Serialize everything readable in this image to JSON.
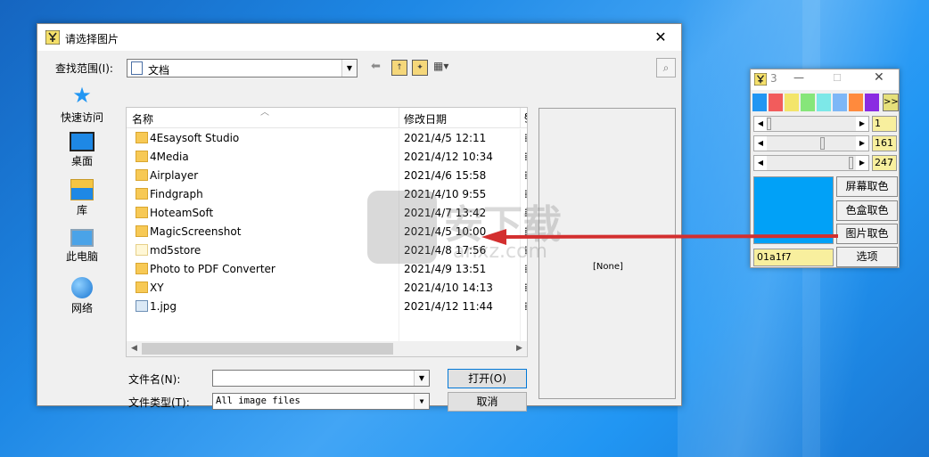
{
  "colors": {
    "desktop": "#1e88e5",
    "arrow": "#d32f2f",
    "current_color": "#01a1f7",
    "swatches": [
      "#2196f3",
      "#f25c5c",
      "#f3e56a",
      "#86e67a",
      "#7de8e8",
      "#7db7f7",
      "#ff8a3d",
      "#8a2be2"
    ]
  },
  "dialog": {
    "title": "请选择图片",
    "close_glyph": "✕",
    "lookin_label": "查找范围(I):",
    "lookin_value": "文档",
    "places": [
      {
        "label": "快速访问",
        "icon": "star-icon"
      },
      {
        "label": "桌面",
        "icon": "desktop-icon"
      },
      {
        "label": "库",
        "icon": "library-icon"
      },
      {
        "label": "此电脑",
        "icon": "computer-icon"
      },
      {
        "label": "网络",
        "icon": "network-icon"
      }
    ],
    "columns": {
      "name": "名称",
      "date": "修改日期",
      "more": "§"
    },
    "files": [
      {
        "name": "4Esaysoft Studio",
        "date": "2021/4/5 12:11",
        "type": "folder",
        "more": "⁞"
      },
      {
        "name": "4Media",
        "date": "2021/4/12 10:34",
        "type": "folder",
        "more": "⁞"
      },
      {
        "name": "Airplayer",
        "date": "2021/4/6 15:58",
        "type": "folder",
        "more": "⁞"
      },
      {
        "name": "Findgraph",
        "date": "2021/4/10 9:55",
        "type": "folder",
        "more": "⁞"
      },
      {
        "name": "HoteamSoft",
        "date": "2021/4/7 13:42",
        "type": "folder",
        "more": "⁞"
      },
      {
        "name": "MagicScreenshot",
        "date": "2021/4/5 10:00",
        "type": "folder",
        "more": "⁞"
      },
      {
        "name": "md5store",
        "date": "2021/4/8 17:56",
        "type": "plain",
        "more": "⁞"
      },
      {
        "name": "Photo to PDF Converter",
        "date": "2021/4/9 13:51",
        "type": "folder",
        "more": "⁞"
      },
      {
        "name": "XY",
        "date": "2021/4/10 14:13",
        "type": "folder",
        "more": "⁞"
      },
      {
        "name": "1.jpg",
        "date": "2021/4/12 11:44",
        "type": "image",
        "more": "⁞"
      }
    ],
    "preview_text": "[None]",
    "filename_label": "文件名(N):",
    "filename_value": "",
    "filetype_label": "文件类型(T):",
    "filetype_value": "All image files",
    "open_button": "打开(O)",
    "cancel_button": "取消"
  },
  "tool": {
    "title_glyph": "3",
    "more_button": ">>",
    "sliders": [
      {
        "value": "1",
        "level": 0.0
      },
      {
        "value": "161",
        "level": 0.63
      },
      {
        "value": "247",
        "level": 0.97
      }
    ],
    "buttons": [
      "屏幕取色",
      "色盒取色",
      "图片取色"
    ],
    "hex_value": "01a1f7",
    "options_button": "选项"
  },
  "watermark": {
    "text": "安下载",
    "sub": "anxz.com"
  }
}
